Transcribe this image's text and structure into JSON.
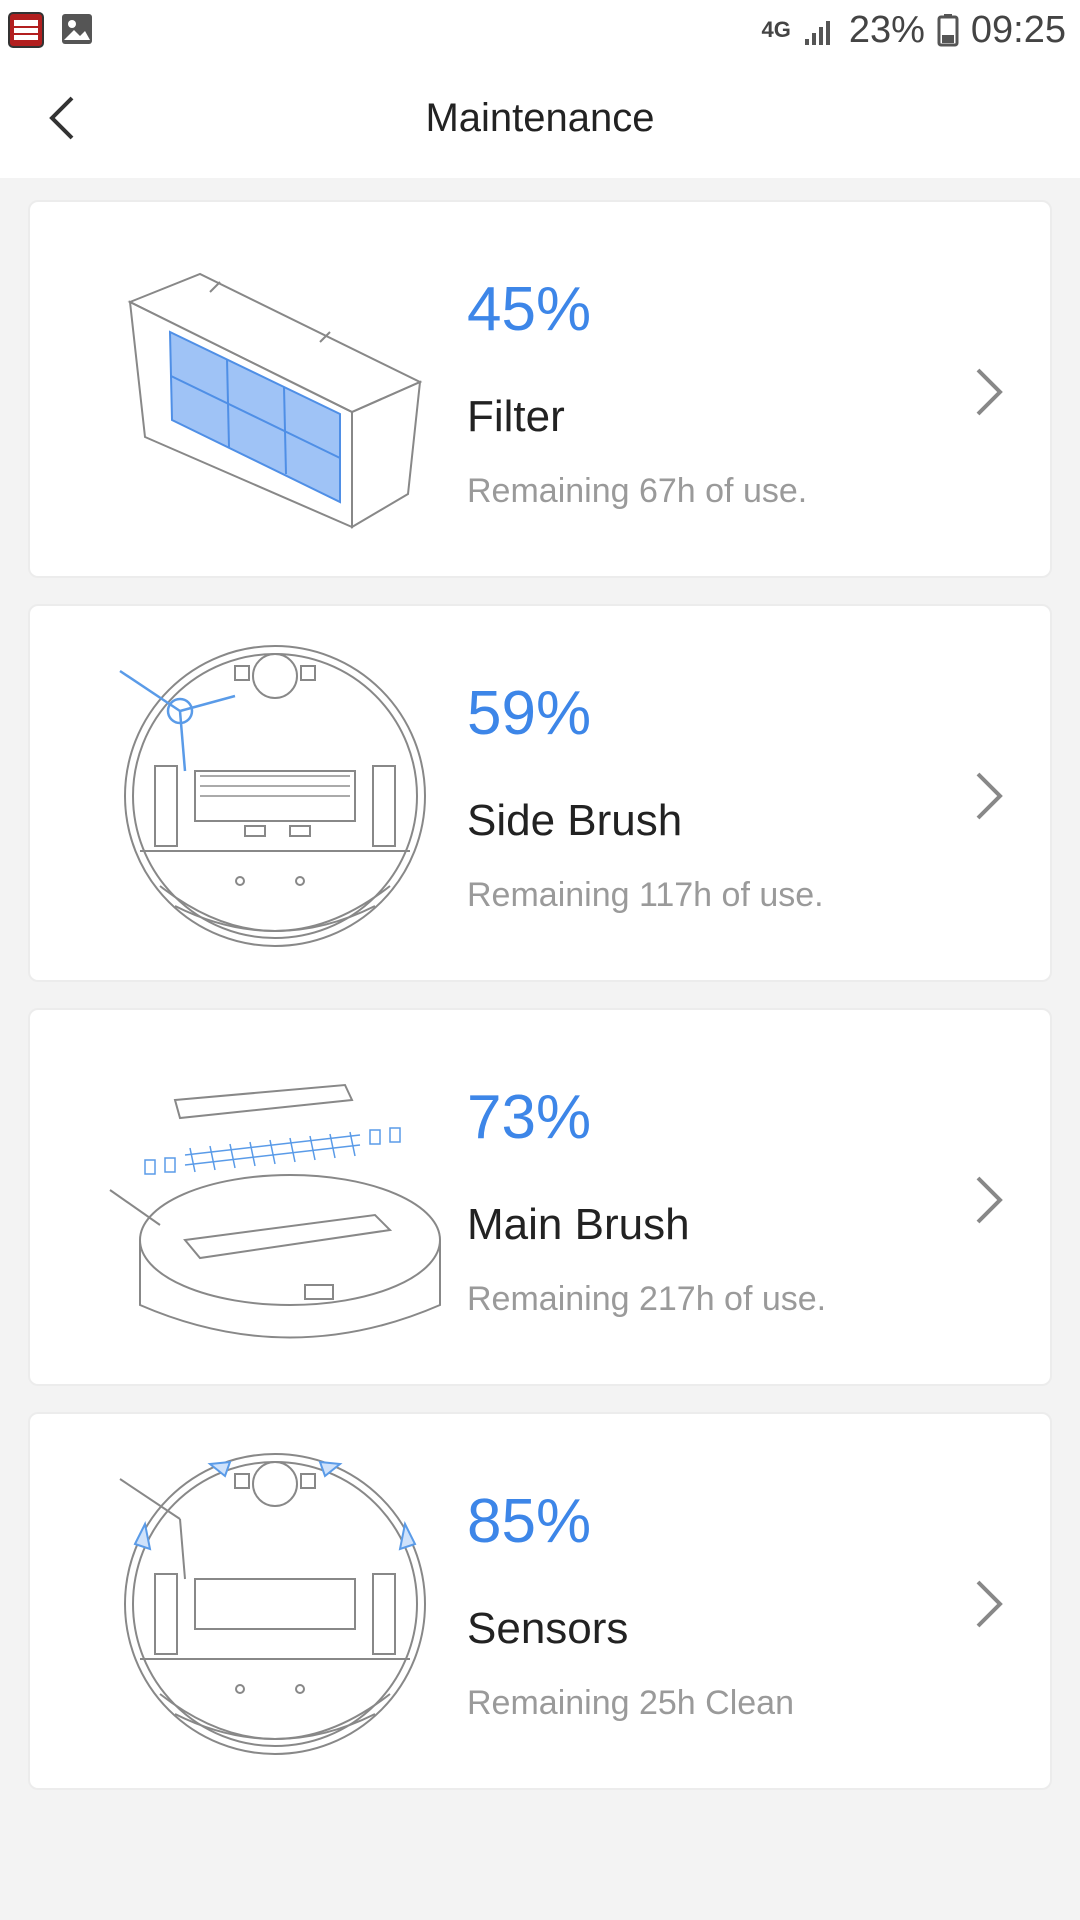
{
  "status_bar": {
    "network": "4G",
    "battery": "23%",
    "time": "09:25"
  },
  "header": {
    "title": "Maintenance"
  },
  "items": [
    {
      "percent": "45%",
      "name": "Filter",
      "remaining": "Remaining 67h of use.",
      "icon": "filter-illustration"
    },
    {
      "percent": "59%",
      "name": "Side Brush",
      "remaining": "Remaining 117h of use.",
      "icon": "side-brush-illustration"
    },
    {
      "percent": "73%",
      "name": "Main Brush",
      "remaining": "Remaining 217h of use.",
      "icon": "main-brush-illustration"
    },
    {
      "percent": "85%",
      "name": "Sensors",
      "remaining": "Remaining 25h Clean",
      "icon": "sensors-illustration"
    }
  ],
  "colors": {
    "accent": "#3d86e8",
    "background": "#f3f3f3"
  }
}
